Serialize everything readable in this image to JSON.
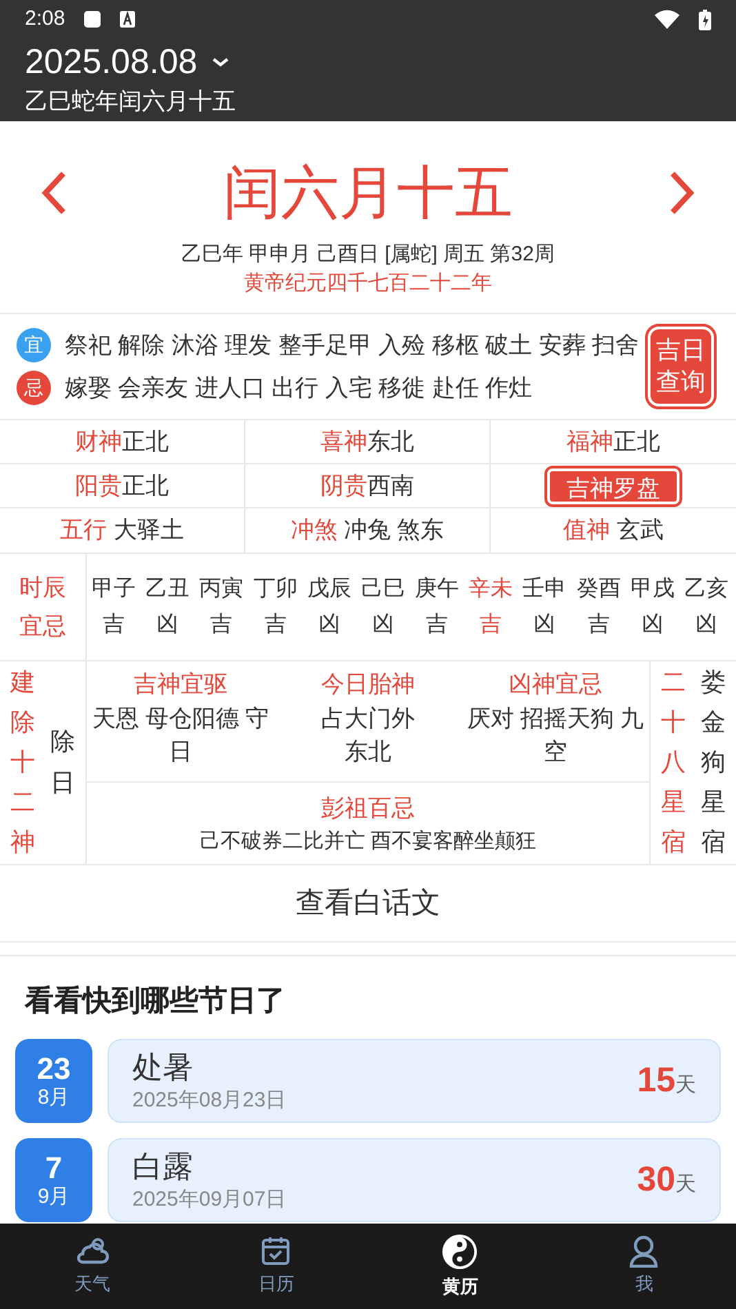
{
  "status_bar": {
    "time": "2:08"
  },
  "header": {
    "date": "2025.08.08",
    "lunar": "乙巳蛇年闰六月十五"
  },
  "day": {
    "title": "闰六月十五",
    "ganzhi": "乙巳年 甲申月 己酉日 [属蛇] 周五 第32周",
    "era": "黄帝纪元四千七百二十二年"
  },
  "yiji": [
    {
      "kind": "yi",
      "badge": "宜",
      "text": "祭祀 解除 沐浴 理发 整手足甲 入殓 移柩 破土 安葬 扫舍"
    },
    {
      "kind": "ji",
      "badge": "忌",
      "text": "嫁娶 会亲友 进人口 出行 入宅 移徙 赴任 作灶"
    }
  ],
  "lucky_day_button": "吉日查询",
  "gods": [
    [
      {
        "kind": "pair",
        "label": "财神",
        "value": "正北"
      },
      {
        "kind": "pair",
        "label": "喜神",
        "value": "东北"
      },
      {
        "kind": "pair",
        "label": "福神",
        "value": "正北"
      }
    ],
    [
      {
        "kind": "pair",
        "label": "阳贵",
        "value": "正北"
      },
      {
        "kind": "pair",
        "label": "阴贵",
        "value": "西南"
      },
      {
        "kind": "button",
        "label": "吉神罗盘"
      }
    ],
    [
      {
        "kind": "pair",
        "label": "五行",
        "value": "大驿土"
      },
      {
        "kind": "pair",
        "label": "冲煞",
        "value": "冲兔 煞东"
      },
      {
        "kind": "pair",
        "label": "值神",
        "value": "玄武"
      }
    ]
  ],
  "hours": {
    "label": "时辰宜忌",
    "items": [
      {
        "name": "甲子",
        "verdict": "吉",
        "selected": false
      },
      {
        "name": "乙丑",
        "verdict": "凶",
        "selected": false
      },
      {
        "name": "丙寅",
        "verdict": "吉",
        "selected": false
      },
      {
        "name": "丁卯",
        "verdict": "吉",
        "selected": false
      },
      {
        "name": "戊辰",
        "verdict": "凶",
        "selected": false
      },
      {
        "name": "己巳",
        "verdict": "凶",
        "selected": false
      },
      {
        "name": "庚午",
        "verdict": "吉",
        "selected": false
      },
      {
        "name": "辛未",
        "verdict": "吉",
        "selected": true
      },
      {
        "name": "壬申",
        "verdict": "凶",
        "selected": false
      },
      {
        "name": "癸酉",
        "verdict": "吉",
        "selected": false
      },
      {
        "name": "甲戌",
        "verdict": "凶",
        "selected": false
      },
      {
        "name": "乙亥",
        "verdict": "凶",
        "selected": false
      }
    ]
  },
  "jianchu": {
    "label": "建除十二神",
    "value": "除日"
  },
  "columns": [
    {
      "title": "吉神宜驱",
      "text": "天恩 母仓阳德 守日"
    },
    {
      "title": "今日胎神",
      "text": "占大门外东北"
    },
    {
      "title": "凶神宜忌",
      "text": "厌对 招摇天狗 九空"
    }
  ],
  "pengzu": {
    "title": "彭祖百忌",
    "text": "己不破券二比并亡 酉不宴客醉坐颠狂"
  },
  "xingxiu": {
    "label": "二十八星宿",
    "value": "娄金狗星宿"
  },
  "vernacular_button": "查看白话文",
  "festivals": {
    "title": "看看快到哪些节日了",
    "items": [
      {
        "day": "23",
        "month": "8月",
        "name": "处暑",
        "date": "2025年08月23日",
        "count": "15",
        "unit": "天"
      },
      {
        "day": "7",
        "month": "9月",
        "name": "白露",
        "date": "2025年09月07日",
        "count": "30",
        "unit": "天"
      }
    ]
  },
  "nav": [
    {
      "kind": "weather",
      "label": "天气",
      "selected": false
    },
    {
      "kind": "calendar",
      "label": "日历",
      "selected": false
    },
    {
      "kind": "almanac",
      "label": "黄历",
      "selected": true
    },
    {
      "kind": "me",
      "label": "我",
      "selected": false
    }
  ]
}
